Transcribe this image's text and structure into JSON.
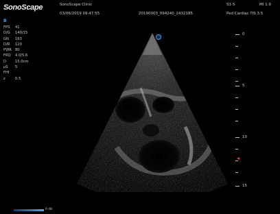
{
  "brand": {
    "logo_text": "SonoScape"
  },
  "header": {
    "institution": "SonoScape Clinic",
    "datetime": "03/06/2019 09:47:55",
    "exam_id": "20190003_094240_2432185",
    "probe": "S1-5",
    "mi": "MI 1.9",
    "preset": "Ped Cardiac TIS 3.5"
  },
  "image_label": "B",
  "params": [
    {
      "key": "FPS",
      "value": "41"
    },
    {
      "key": "D/G",
      "value": "140/15"
    },
    {
      "key": "GN",
      "value": "163"
    },
    {
      "key": "D/R",
      "value": "120"
    },
    {
      "key": "PWR",
      "value": "80"
    },
    {
      "key": "FRQ",
      "value": "4.0/5.6"
    },
    {
      "key": "D",
      "value": "15.0cm"
    },
    {
      "key": "μS",
      "value": "5"
    },
    {
      "key": "FHI",
      "value": ""
    },
    {
      "key": "z",
      "value": "0.5"
    }
  ],
  "depth_scale": {
    "labels": [
      "0",
      "5",
      "10",
      "15"
    ]
  },
  "footer": {
    "db_label": "0 dB"
  },
  "colors": {
    "background": "#000000",
    "accent_blue": "#48a8f0",
    "focus_marker": "#d04a3a"
  }
}
